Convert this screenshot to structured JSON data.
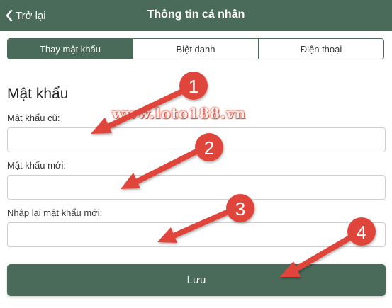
{
  "header": {
    "back_label": "Trở lại",
    "title": "Thông tin cá nhân"
  },
  "tabs": [
    {
      "label": "Thay mật khẩu",
      "active": true
    },
    {
      "label": "Biệt danh",
      "active": false
    },
    {
      "label": "Điện thoại",
      "active": false
    }
  ],
  "form": {
    "section_title": "Mật khẩu",
    "old_password_label": "Mật khẩu cũ:",
    "new_password_label": "Mật khẩu mới:",
    "confirm_password_label": "Nhập lại mật khẩu mới:",
    "old_password_value": "",
    "new_password_value": "",
    "confirm_password_value": "",
    "save_label": "Lưu"
  },
  "watermark": "www.loto188.vn",
  "annotations": [
    "1",
    "2",
    "3",
    "4"
  ],
  "colors": {
    "primary": "#4a6b59",
    "annotation": "#e0453b"
  }
}
